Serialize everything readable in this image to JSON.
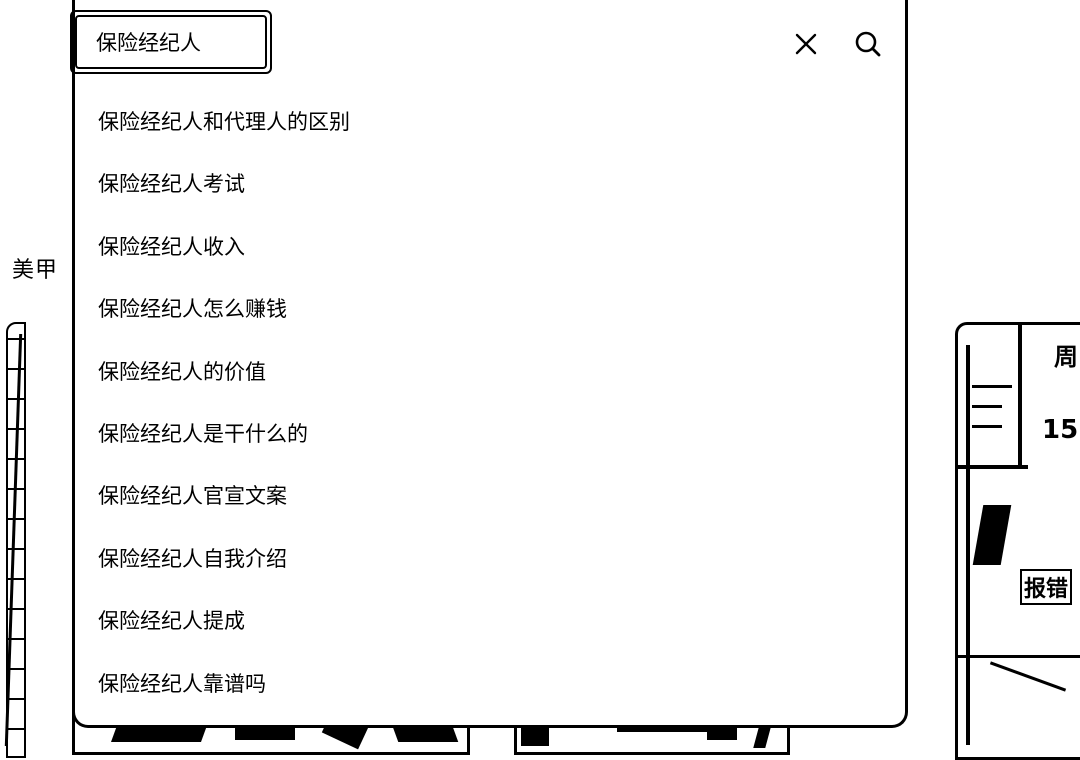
{
  "search": {
    "query": "保险经纪人",
    "clear_icon": "close-icon",
    "search_icon": "search-icon"
  },
  "suggestions": [
    "保险经纪人和代理人的区别",
    "保险经纪人考试",
    "保险经纪人收入",
    "保险经纪人怎么赚钱",
    "保险经纪人的价值",
    "保险经纪人是干什么的",
    "保险经纪人官宣文案",
    "保险经纪人自我介绍",
    "保险经纪人提成",
    "保险经纪人靠谱吗"
  ],
  "background": {
    "side_label": "美甲",
    "right_card_tag": "报错",
    "right_card_number": "15",
    "right_card_top_char": "周"
  }
}
